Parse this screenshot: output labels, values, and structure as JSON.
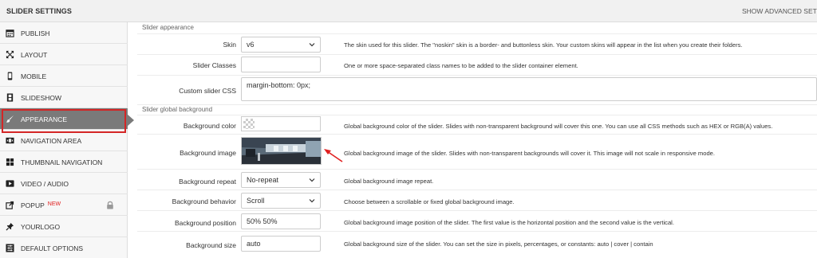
{
  "header": {
    "title": "SLIDER SETTINGS",
    "advanced_link": "SHOW ADVANCED SETT"
  },
  "sidebar": {
    "items": [
      {
        "label": "PUBLISH",
        "icon": "calendar-icon"
      },
      {
        "label": "LAYOUT",
        "icon": "expand-arrows-icon"
      },
      {
        "label": "MOBILE",
        "icon": "mobile-icon"
      },
      {
        "label": "SLIDESHOW",
        "icon": "film-icon"
      },
      {
        "label": "APPEARANCE",
        "icon": "paint-brush-icon",
        "active": true
      },
      {
        "label": "NAVIGATION AREA",
        "icon": "navigation-arrows-icon"
      },
      {
        "label": "THUMBNAIL NAVIGATION",
        "icon": "grid-icon"
      },
      {
        "label": "VIDEO / AUDIO",
        "icon": "play-icon"
      },
      {
        "label": "POPUP",
        "icon": "popup-icon",
        "badge": "NEW",
        "locked": true
      },
      {
        "label": "YOURLOGO",
        "icon": "pin-icon"
      },
      {
        "label": "DEFAULT OPTIONS",
        "icon": "options-icon"
      }
    ],
    "active_color": "#7a7a7a",
    "highlight_color": "#d42626"
  },
  "main": {
    "section_appearance": "Slider appearance",
    "section_background": "Slider global background",
    "skin": {
      "label": "Skin",
      "value": "v6",
      "desc": "The skin used for this slider. The \"noskin\" skin is a border- and buttonless skin. Your custom skins will appear in the list when you create their folders."
    },
    "classes": {
      "label": "Slider Classes",
      "value": "",
      "desc": "One or more space-separated class names to be added to the slider container element."
    },
    "css": {
      "label": "Custom slider CSS",
      "value": "margin-bottom: 0px;"
    },
    "bg_color": {
      "label": "Background color",
      "desc": "Global background color of the slider. Slides with non-transparent background will cover this one. You can use all CSS methods such as HEX or RGB(A) values."
    },
    "bg_image": {
      "label": "Background image",
      "desc": "Global background image of the slider. Slides with non-transparent backgrounds will cover it. This image will not scale in responsive mode."
    },
    "bg_repeat": {
      "label": "Background repeat",
      "value": "No-repeat",
      "desc": "Global background image repeat."
    },
    "bg_behavior": {
      "label": "Background behavior",
      "value": "Scroll",
      "desc": "Choose between a scrollable or fixed global background image."
    },
    "bg_position": {
      "label": "Background position",
      "value": "50% 50%",
      "desc": "Global background image position of the slider. The first value is the horizontal position and the second value is the vertical."
    },
    "bg_size": {
      "label": "Background size",
      "value": "auto",
      "desc": "Global background size of the slider. You can set the size in pixels, percentages, or constants: auto | cover | contain"
    }
  }
}
